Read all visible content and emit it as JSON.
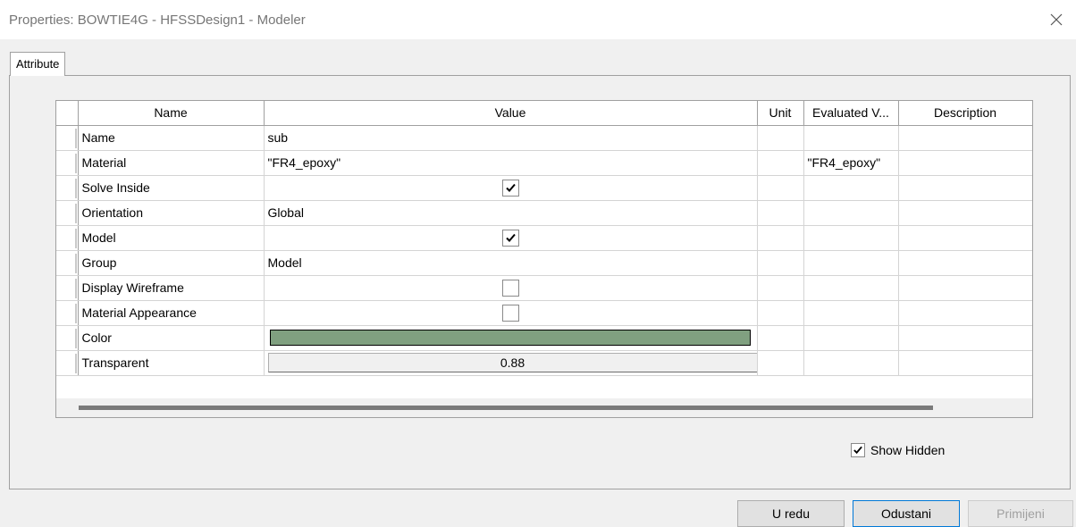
{
  "window": {
    "title": "Properties: BOWTIE4G - HFSSDesign1 - Modeler",
    "close_icon": "close-icon"
  },
  "tabs": [
    {
      "label": "Attribute",
      "active": true
    }
  ],
  "grid": {
    "columns": [
      "Name",
      "Value",
      "Unit",
      "Evaluated V...",
      "Description"
    ],
    "rows": [
      {
        "name": "Name",
        "value": "sub",
        "kind": "text",
        "unit": "",
        "evaluated": "",
        "description": ""
      },
      {
        "name": "Material",
        "value": "\"FR4_epoxy\"",
        "kind": "text",
        "unit": "",
        "evaluated": "\"FR4_epoxy\"",
        "description": ""
      },
      {
        "name": "Solve Inside",
        "kind": "checkbox",
        "checked": true,
        "unit": "",
        "evaluated": "",
        "description": ""
      },
      {
        "name": "Orientation",
        "value": "Global",
        "kind": "text",
        "unit": "",
        "evaluated": "",
        "description": ""
      },
      {
        "name": "Model",
        "kind": "checkbox",
        "checked": true,
        "unit": "",
        "evaluated": "",
        "description": ""
      },
      {
        "name": "Group",
        "value": "Model",
        "kind": "text",
        "unit": "",
        "evaluated": "",
        "description": ""
      },
      {
        "name": "Display Wireframe",
        "kind": "checkbox",
        "checked": false,
        "unit": "",
        "evaluated": "",
        "description": ""
      },
      {
        "name": "Material Appearance",
        "kind": "checkbox",
        "checked": false,
        "unit": "",
        "evaluated": "",
        "description": ""
      },
      {
        "name": "Color",
        "kind": "color",
        "color": "#80a080",
        "unit": "",
        "evaluated": "",
        "description": ""
      },
      {
        "name": "Transparent",
        "value": "0.88",
        "kind": "button",
        "unit": "",
        "evaluated": "",
        "description": ""
      }
    ]
  },
  "show_hidden": {
    "label": "Show Hidden",
    "checked": true
  },
  "buttons": {
    "ok": "U redu",
    "cancel": "Odustani",
    "apply": "Primijeni"
  },
  "colors": {
    "accent": "#0078d7",
    "disabled_text": "#a0a0a0"
  }
}
